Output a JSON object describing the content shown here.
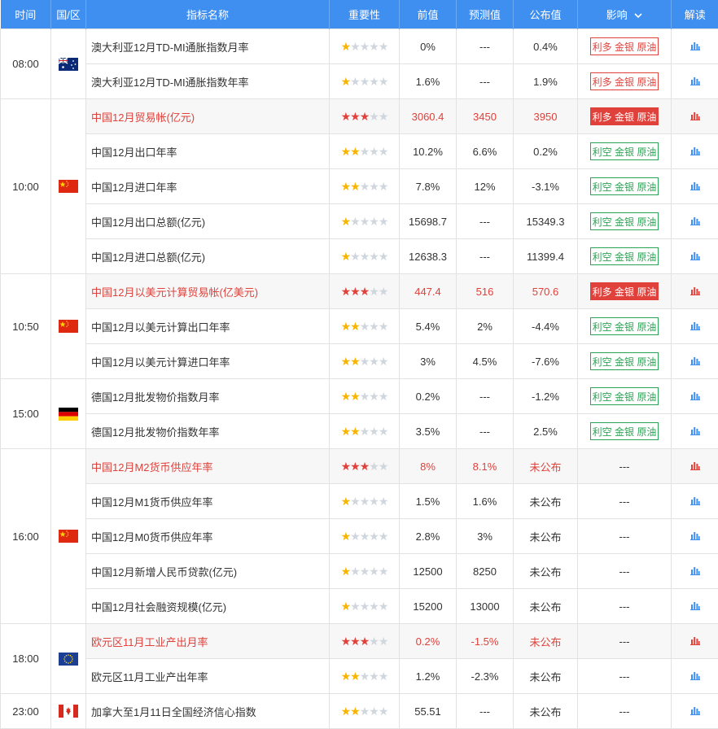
{
  "headers": {
    "time": "时间",
    "region": "国/区",
    "name": "指标名称",
    "importance": "重要性",
    "previous": "前值",
    "forecast": "预测值",
    "actual": "公布值",
    "effect": "影响",
    "reading": "解读"
  },
  "colors": {
    "header_bg": "#3f8ff0",
    "bullish": "#e0413b",
    "bearish": "#2aa454",
    "star": "#f7b500"
  },
  "groups": [
    {
      "time": "08:00",
      "flag": "australia-flag-icon",
      "rows": [
        {
          "name": "澳大利亚12月TD-MI通胀指数月率",
          "stars": 1,
          "prev": "0%",
          "forecast": "---",
          "actual": "0.4%",
          "effect": "利多 金银 原油",
          "effect_type": "bull-out",
          "hi": false
        },
        {
          "name": "澳大利亚12月TD-MI通胀指数年率",
          "stars": 1,
          "prev": "1.6%",
          "forecast": "---",
          "actual": "1.9%",
          "effect": "利多 金银 原油",
          "effect_type": "bull-out",
          "hi": false
        }
      ]
    },
    {
      "time": "10:00",
      "flag": "china-flag-icon",
      "rows": [
        {
          "name": "中国12月贸易帐(亿元)",
          "stars": 3,
          "prev": "3060.4",
          "forecast": "3450",
          "actual": "3950",
          "effect": "利多 金银 原油",
          "effect_type": "bull-fill",
          "hi": true
        },
        {
          "name": "中国12月出口年率",
          "stars": 2,
          "prev": "10.2%",
          "forecast": "6.6%",
          "actual": "0.2%",
          "effect": "利空 金银 原油",
          "effect_type": "bear-out",
          "hi": false
        },
        {
          "name": "中国12月进口年率",
          "stars": 2,
          "prev": "7.8%",
          "forecast": "12%",
          "actual": "-3.1%",
          "effect": "利空 金银 原油",
          "effect_type": "bear-out",
          "hi": false
        },
        {
          "name": "中国12月出口总额(亿元)",
          "stars": 1,
          "prev": "15698.7",
          "forecast": "---",
          "actual": "15349.3",
          "effect": "利空 金银 原油",
          "effect_type": "bear-out",
          "hi": false
        },
        {
          "name": "中国12月进口总额(亿元)",
          "stars": 1,
          "prev": "12638.3",
          "forecast": "---",
          "actual": "11399.4",
          "effect": "利空 金银 原油",
          "effect_type": "bear-out",
          "hi": false
        }
      ]
    },
    {
      "time": "10:50",
      "flag": "china-flag-icon",
      "rows": [
        {
          "name": "中国12月以美元计算贸易帐(亿美元)",
          "stars": 3,
          "prev": "447.4",
          "forecast": "516",
          "actual": "570.6",
          "effect": "利多 金银 原油",
          "effect_type": "bull-fill",
          "hi": true
        },
        {
          "name": "中国12月以美元计算出口年率",
          "stars": 2,
          "prev": "5.4%",
          "forecast": "2%",
          "actual": "-4.4%",
          "effect": "利空 金银 原油",
          "effect_type": "bear-out",
          "hi": false
        },
        {
          "name": "中国12月以美元计算进口年率",
          "stars": 2,
          "prev": "3%",
          "forecast": "4.5%",
          "actual": "-7.6%",
          "effect": "利空 金银 原油",
          "effect_type": "bear-out",
          "hi": false
        }
      ]
    },
    {
      "time": "15:00",
      "flag": "germany-flag-icon",
      "rows": [
        {
          "name": "德国12月批发物价指数月率",
          "stars": 2,
          "prev": "0.2%",
          "forecast": "---",
          "actual": "-1.2%",
          "effect": "利空 金银 原油",
          "effect_type": "bear-out",
          "hi": false
        },
        {
          "name": "德国12月批发物价指数年率",
          "stars": 2,
          "prev": "3.5%",
          "forecast": "---",
          "actual": "2.5%",
          "effect": "利空 金银 原油",
          "effect_type": "bear-out",
          "hi": false
        }
      ]
    },
    {
      "time": "16:00",
      "flag": "china-flag-icon",
      "rows": [
        {
          "name": "中国12月M2货币供应年率",
          "stars": 3,
          "prev": "8%",
          "forecast": "8.1%",
          "actual": "未公布",
          "effect": "---",
          "effect_type": "none",
          "hi": true
        },
        {
          "name": "中国12月M1货币供应年率",
          "stars": 1,
          "prev": "1.5%",
          "forecast": "1.6%",
          "actual": "未公布",
          "effect": "---",
          "effect_type": "none",
          "hi": false
        },
        {
          "name": "中国12月M0货币供应年率",
          "stars": 1,
          "prev": "2.8%",
          "forecast": "3%",
          "actual": "未公布",
          "effect": "---",
          "effect_type": "none",
          "hi": false
        },
        {
          "name": "中国12月新增人民币贷款(亿元)",
          "stars": 1,
          "prev": "12500",
          "forecast": "8250",
          "actual": "未公布",
          "effect": "---",
          "effect_type": "none",
          "hi": false
        },
        {
          "name": "中国12月社会融资规模(亿元)",
          "stars": 1,
          "prev": "15200",
          "forecast": "13000",
          "actual": "未公布",
          "effect": "---",
          "effect_type": "none",
          "hi": false
        }
      ]
    },
    {
      "time": "18:00",
      "flag": "eu-flag-icon",
      "rows": [
        {
          "name": "欧元区11月工业产出月率",
          "stars": 3,
          "prev": "0.2%",
          "forecast": "-1.5%",
          "actual": "未公布",
          "effect": "---",
          "effect_type": "none",
          "hi": true
        },
        {
          "name": "欧元区11月工业产出年率",
          "stars": 2,
          "prev": "1.2%",
          "forecast": "-2.3%",
          "actual": "未公布",
          "effect": "---",
          "effect_type": "none",
          "hi": false
        }
      ]
    },
    {
      "time": "23:00",
      "flag": "canada-flag-icon",
      "rows": [
        {
          "name": "加拿大至1月11日全国经济信心指数",
          "stars": 2,
          "prev": "55.51",
          "forecast": "---",
          "actual": "未公布",
          "effect": "---",
          "effect_type": "none",
          "hi": false
        }
      ]
    }
  ]
}
